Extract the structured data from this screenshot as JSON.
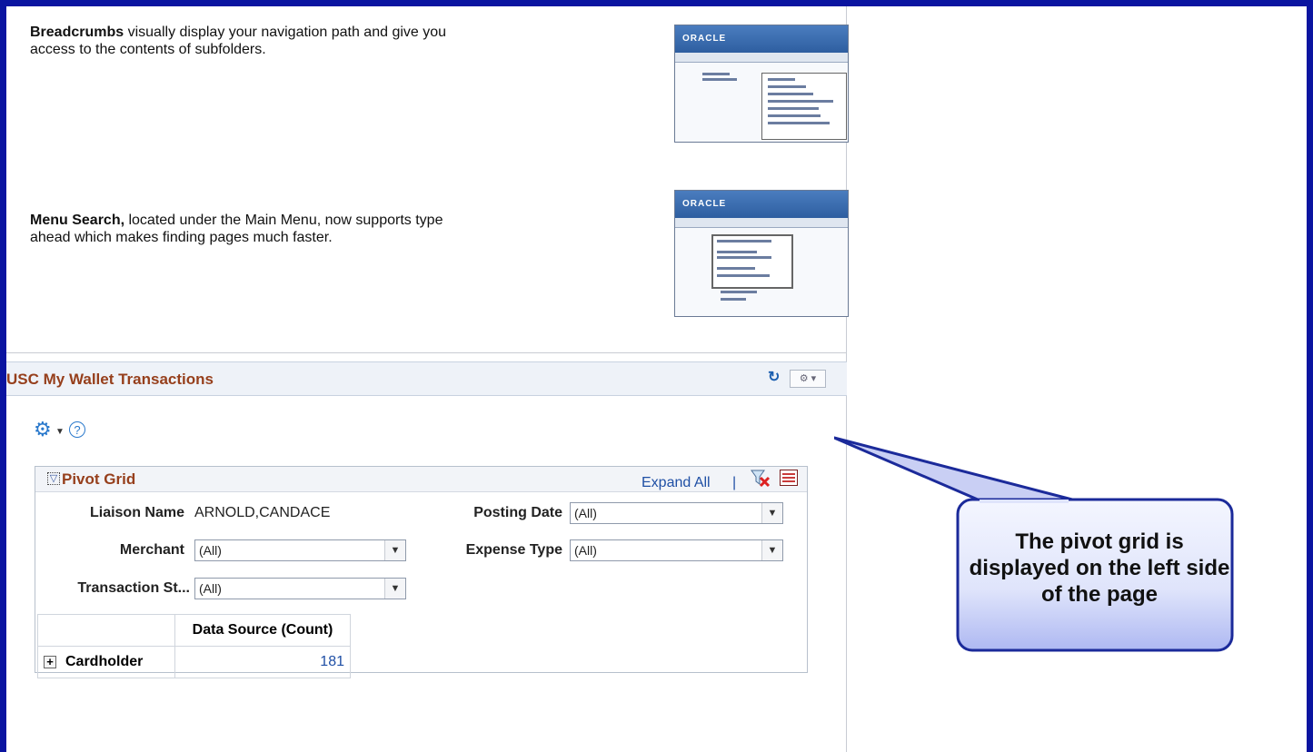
{
  "tips": [
    {
      "bold": "Breadcrumbs",
      "rest": " visually display your navigation path and give you access to the contents of subfolders."
    },
    {
      "bold": "Menu Search,",
      "rest": " located under the Main Menu, now supports type ahead which makes finding pages much faster."
    }
  ],
  "thumb": {
    "brand": "ORACLE"
  },
  "pagelet": {
    "title": "USC My Wallet Transactions"
  },
  "icons": {
    "refresh": "refresh-icon",
    "settings": "gear-icon",
    "help": "help-icon"
  },
  "pivot": {
    "title": "Pivot Grid",
    "expand_all": "Expand All",
    "separator": "|",
    "filters": {
      "liaison_label": "Liaison Name",
      "liaison_value": "ARNOLD,CANDACE",
      "posting_label": "Posting Date",
      "posting_value": "(All)",
      "merchant_label": "Merchant",
      "merchant_value": "(All)",
      "expense_label": "Expense Type",
      "expense_value": "(All)",
      "transaction_label": "Transaction St...",
      "transaction_value": "(All)"
    },
    "table": {
      "column_header": "Data Source (Count)",
      "row_label": "Cardholder",
      "row_value": "181"
    }
  },
  "callout": {
    "text": "The pivot grid is displayed on the left side of the page"
  },
  "colors": {
    "frame": "#0a14a0",
    "title": "#963f1c",
    "link": "#1f4fa5"
  }
}
